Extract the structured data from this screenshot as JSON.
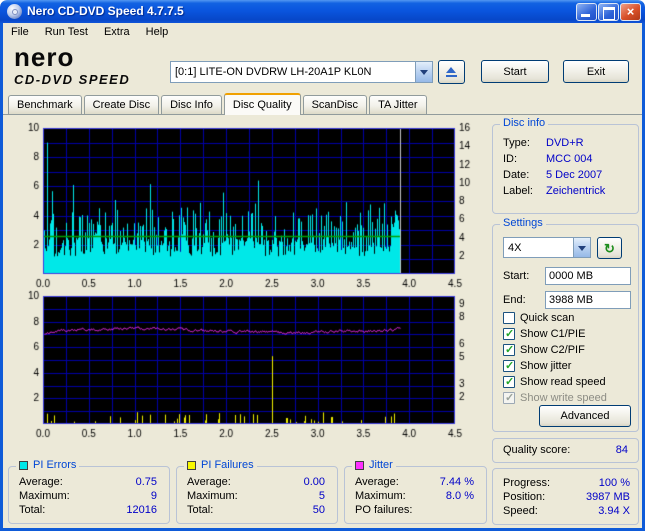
{
  "window": {
    "title": "Nero CD-DVD Speed 4.7.7.5"
  },
  "menu": {
    "items": [
      "File",
      "Run Test",
      "Extra",
      "Help"
    ]
  },
  "logo": {
    "brand": "nero",
    "product": "CD-DVD SPEED"
  },
  "toolbar": {
    "drive": "[0:1]   LITE-ON DVDRW LH-20A1P KL0N",
    "start": "Start",
    "exit": "Exit"
  },
  "tabs": {
    "items": [
      "Benchmark",
      "Create Disc",
      "Disc Info",
      "Disc Quality",
      "ScanDisc",
      "TA Jitter"
    ],
    "active_index": 3
  },
  "disc_info": {
    "caption": "Disc info",
    "rows": [
      {
        "label": "Type:",
        "value": "DVD+R"
      },
      {
        "label": "ID:",
        "value": "MCC 004"
      },
      {
        "label": "Date:",
        "value": "5 Dec 2007"
      },
      {
        "label": "Label:",
        "value": "Zeichentrick"
      }
    ]
  },
  "settings": {
    "caption": "Settings",
    "speed": "4X",
    "start_label": "Start:",
    "start_value": "0000 MB",
    "end_label": "End:",
    "end_value": "3988 MB",
    "checkboxes": [
      {
        "label": "Quick scan",
        "checked": false,
        "enabled": true
      },
      {
        "label": "Show C1/PIE",
        "checked": true,
        "enabled": true
      },
      {
        "label": "Show C2/PIF",
        "checked": true,
        "enabled": true
      },
      {
        "label": "Show jitter",
        "checked": true,
        "enabled": true
      },
      {
        "label": "Show read speed",
        "checked": true,
        "enabled": true
      },
      {
        "label": "Show write speed",
        "checked": true,
        "enabled": false
      }
    ],
    "advanced": "Advanced"
  },
  "quality": {
    "label": "Quality score:",
    "value": "84"
  },
  "status": {
    "rows": [
      {
        "label": "Progress:",
        "value": "100 %"
      },
      {
        "label": "Position:",
        "value": "3987 MB"
      },
      {
        "label": "Speed:",
        "value": "3.94 X"
      }
    ]
  },
  "stats": {
    "pi_errors": {
      "caption": "PI Errors",
      "color": "#00E8E8",
      "rows": [
        {
          "label": "Average:",
          "value": "0.75"
        },
        {
          "label": "Maximum:",
          "value": "9"
        },
        {
          "label": "Total:",
          "value": "12016"
        }
      ]
    },
    "pi_failures": {
      "caption": "PI Failures",
      "color": "#F8F800",
      "rows": [
        {
          "label": "Average:",
          "value": "0.00"
        },
        {
          "label": "Maximum:",
          "value": "5"
        },
        {
          "label": "Total:",
          "value": "50"
        }
      ]
    },
    "jitter": {
      "caption": "Jitter",
      "color": "#FF30FF",
      "rows": [
        {
          "label": "Average:",
          "value": "7.44 %"
        },
        {
          "label": "Maximum:",
          "value": "8.0 %"
        },
        {
          "label": "PO failures:",
          "value": ""
        }
      ]
    }
  },
  "chart_data": [
    {
      "type": "area",
      "name": "PI Errors / read speed",
      "background": "#000000",
      "grid": {
        "color": "#0000A8",
        "x_step": 0.25,
        "y_step": 1
      },
      "x_axis": {
        "min": 0,
        "max": 4.5,
        "tick_labels": [
          "0.0",
          "0.5",
          "1.0",
          "1.5",
          "2.0",
          "2.5",
          "3.0",
          "3.5",
          "4.0",
          "4.5"
        ]
      },
      "y_left_axis": {
        "min": 0,
        "max": 10,
        "ticks": [
          2,
          4,
          6,
          8,
          10
        ]
      },
      "y_right_axis": {
        "min": 0,
        "max": 16,
        "ticks": [
          2,
          4,
          6,
          8,
          10,
          12,
          14,
          16
        ]
      },
      "scan_end_x": 3.9,
      "series": [
        {
          "name": "PI Errors",
          "style": "spike-area",
          "color": "#00E8E8",
          "average": 0.75,
          "maximum": 9,
          "total": 12016,
          "seed": 1207
        },
        {
          "name": "Read speed",
          "style": "line",
          "color": "#00A000",
          "value_on_right_axis": 4
        }
      ]
    },
    {
      "type": "line",
      "name": "Jitter / PI failures",
      "background": "#000000",
      "grid": {
        "color": "#0000A8",
        "x_step": 0.25,
        "y_step": 1
      },
      "x_axis": {
        "min": 0,
        "max": 4.5,
        "tick_labels": [
          "0.0",
          "0.5",
          "1.0",
          "1.5",
          "2.0",
          "2.5",
          "3.0",
          "3.5",
          "4.0",
          "4.5"
        ]
      },
      "y_left_axis": {
        "min": 0,
        "max": 10,
        "ticks": [
          2,
          4,
          6,
          8,
          10
        ]
      },
      "y_right_axis": {
        "min": 0,
        "max": 9.6,
        "ticks": [
          2,
          3,
          5,
          6,
          8,
          9
        ]
      },
      "scan_end_x": 3.9,
      "series": [
        {
          "name": "Jitter",
          "style": "line",
          "color": "#FF30FF",
          "average_pct": 7.44,
          "maximum_pct": 8.0,
          "seed": 512
        },
        {
          "name": "PI Failures",
          "style": "spikes",
          "color": "#F0F000",
          "maximum": 5,
          "total": 50,
          "big_spike_x": 2.5,
          "seed": 99
        }
      ]
    }
  ]
}
